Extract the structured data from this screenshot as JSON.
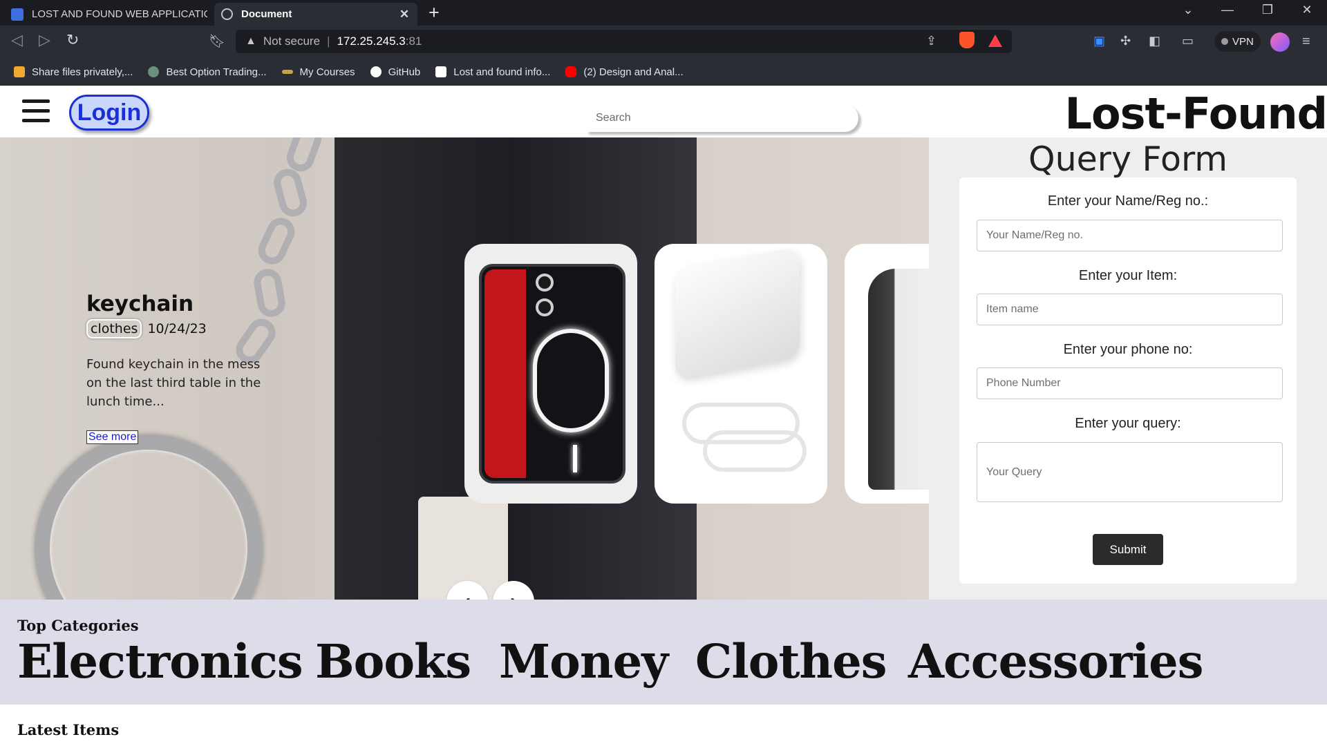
{
  "browser": {
    "tabs": [
      {
        "title": "LOST AND FOUND WEB APPLICATION",
        "active": false
      },
      {
        "title": "Document",
        "active": true
      }
    ],
    "url": {
      "warning": "Not secure",
      "host": "172.25.245.3",
      "port": ":81"
    },
    "vpn_label": "VPN",
    "bookmarks": [
      {
        "label": "Share files privately,...",
        "icon": "share-icon",
        "color": "#f0a830"
      },
      {
        "label": "Best Option Trading...",
        "icon": "globe-icon",
        "color": "#6a8f7a"
      },
      {
        "label": "My Courses",
        "icon": "courses-icon",
        "color": "#c9a24a"
      },
      {
        "label": "GitHub",
        "icon": "github-icon",
        "color": "#ffffff"
      },
      {
        "label": "Lost and found info...",
        "icon": "doc-icon",
        "color": "#ffffff"
      },
      {
        "label": "(2) Design and Anal...",
        "icon": "youtube-icon",
        "color": "#ff0000"
      }
    ]
  },
  "header": {
    "login_label": "Login",
    "search_placeholder": "Search",
    "brand": "Lost-Found"
  },
  "hero": {
    "item": {
      "title": "keychain",
      "category": "clothes",
      "date": "10/24/23",
      "description": "Found keychain in the mess on the last third table in the lunch time...",
      "link_label": "See more"
    },
    "cards": [
      "phone",
      "charger",
      "bottle-bag"
    ],
    "prev_icon": "chevron-left-icon",
    "next_icon": "chevron-right-icon"
  },
  "query_form": {
    "title": "Query Form",
    "fields": [
      {
        "label": "Enter your Name/Reg no.:",
        "placeholder": "Your Name/Reg no."
      },
      {
        "label": "Enter your Item:",
        "placeholder": "Item name"
      },
      {
        "label": "Enter your phone no:",
        "placeholder": "Phone Number"
      },
      {
        "label": "Enter your query:",
        "placeholder": "Your Query"
      }
    ],
    "submit_label": "Submit"
  },
  "categories": {
    "title": "Top Categories",
    "items": [
      "Electronics",
      "Books",
      "Money",
      "Clothes",
      "Accessories"
    ]
  },
  "latest": {
    "title": "Latest Items"
  },
  "colors": {
    "login_border": "#1b2fd6",
    "login_bg": "#c9d7fb",
    "categories_bg": "#dcdde8",
    "chrome_bg": "#2b2d35"
  }
}
